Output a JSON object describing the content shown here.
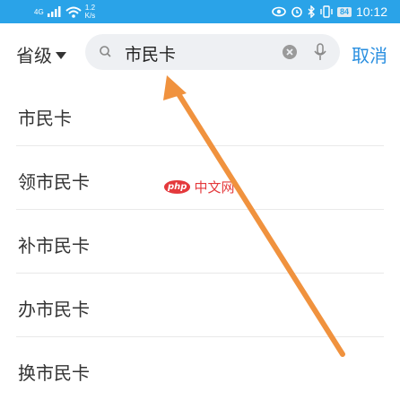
{
  "status_bar": {
    "network_type": "4G",
    "speed_value": "1.2",
    "speed_unit": "K/s",
    "battery": "84",
    "time": "10:12"
  },
  "header": {
    "province_label": "省级",
    "search_query": "市民卡",
    "cancel_label": "取消"
  },
  "suggestions": [
    {
      "label": "市民卡"
    },
    {
      "label": "领市民卡"
    },
    {
      "label": "补市民卡"
    },
    {
      "label": "办市民卡"
    },
    {
      "label": "换市民卡"
    }
  ],
  "watermark": {
    "logo": "php",
    "site": "中文网"
  },
  "colors": {
    "status_bar_bg": "#2aa3e8",
    "accent": "#2a8fe0",
    "search_bg": "#eef0f3",
    "annotation_arrow": "#f0923e"
  },
  "icons": [
    "signal-icon",
    "wifi-icon",
    "eye-icon",
    "alarm-icon",
    "bluetooth-icon",
    "vibrate-icon",
    "battery-icon",
    "search-icon",
    "clear-icon",
    "microphone-icon",
    "dropdown-triangle-icon",
    "annotation-arrow"
  ]
}
